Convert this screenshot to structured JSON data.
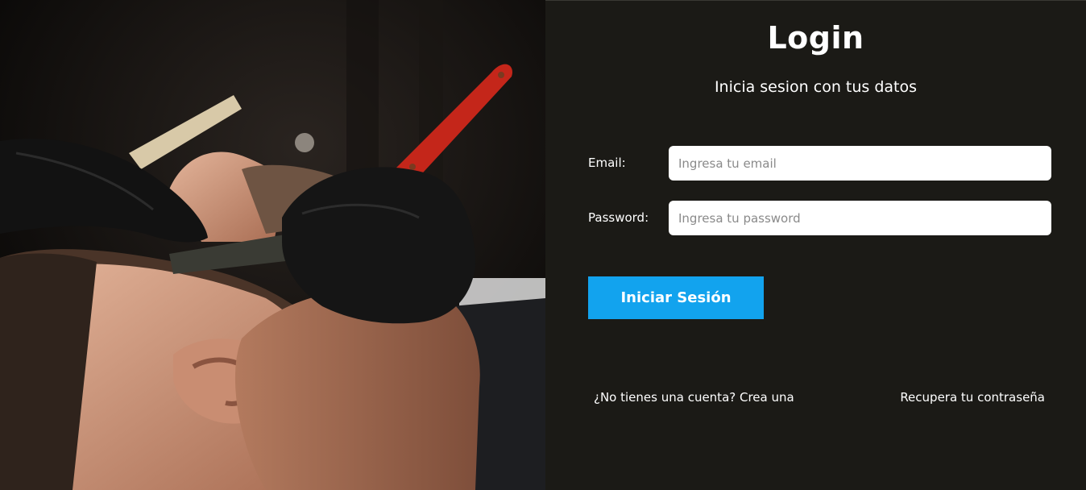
{
  "login": {
    "title": "Login",
    "subtitle": "Inicia sesion con tus datos",
    "email": {
      "label": "Email:",
      "placeholder": "Ingresa tu email",
      "value": ""
    },
    "password": {
      "label": "Password:",
      "placeholder": "Ingresa tu password",
      "value": ""
    },
    "submit_label": "Iniciar Sesión",
    "signup_link": "¿No tienes una cuenta? Crea una",
    "recover_link": "Recupera tu contraseña"
  },
  "colors": {
    "panel_background": "#1b1a16",
    "button_background": "#12a3ee",
    "text": "#ffffff"
  }
}
